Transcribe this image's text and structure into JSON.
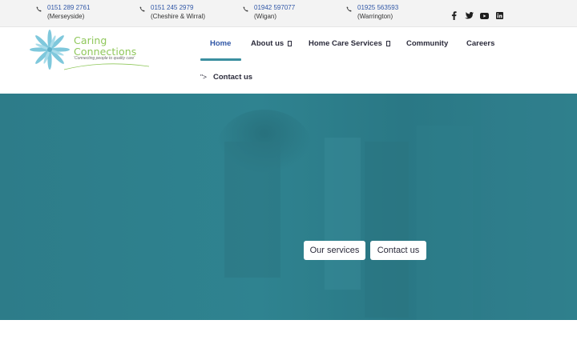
{
  "topbar": {
    "contacts": [
      {
        "number": "0151 289 2761",
        "area": "(Merseyside)"
      },
      {
        "number": "0151 245 2979",
        "area": "(Cheshire & Wirral)"
      },
      {
        "number": "01942 597077",
        "area": "(Wigan)"
      },
      {
        "number": "01925 563593",
        "area": "(Warrington)"
      }
    ],
    "socials": [
      "facebook-icon",
      "twitter-icon",
      "youtube-icon",
      "linkedin-icon"
    ]
  },
  "logo": {
    "line1": "Caring",
    "line2": "Connections",
    "tagline": "'Connecting people to quality care'"
  },
  "nav": {
    "home": "Home",
    "about": "About us",
    "services": "Home Care Services",
    "community": "Community",
    "careers": "Careers",
    "contact_prefix": "\">",
    "contact": "Contact us"
  },
  "hero": {
    "services_button": "Our services",
    "contact_button": "Contact us"
  },
  "colors": {
    "accent": "#2f56a6",
    "hero": "#2e7f8c",
    "underline": "#3b8fa0",
    "logo_green": "#8fc75a",
    "logo_blue": "#7fc8dc"
  }
}
